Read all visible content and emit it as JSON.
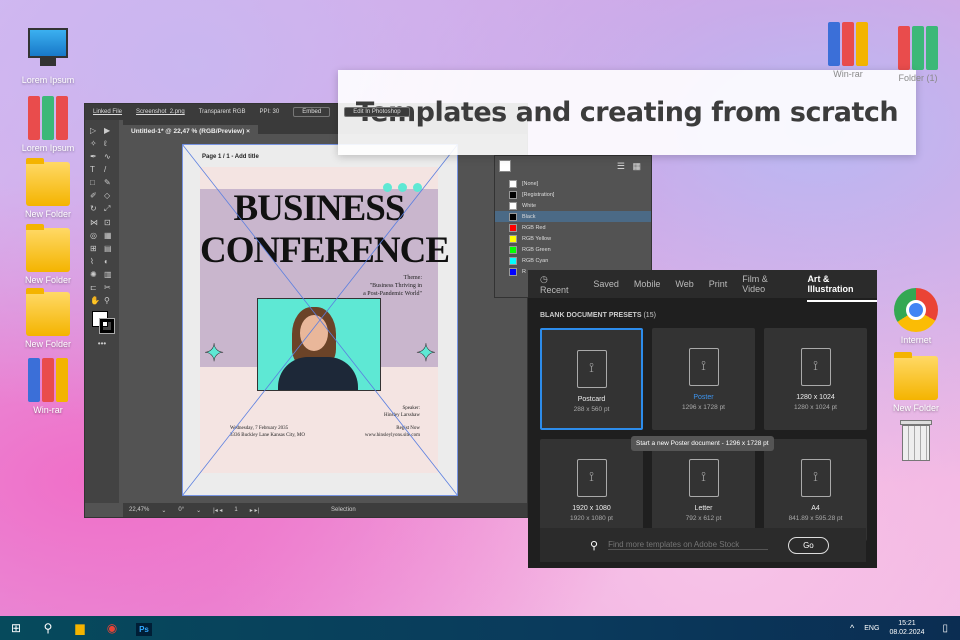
{
  "desktop": {
    "left": [
      {
        "label": "Lorem Ipsum",
        "icon": "computer-icon"
      },
      {
        "label": "Lorem Ipsum",
        "icon": "binders-icon"
      },
      {
        "label": "New Folder",
        "icon": "folder-icon"
      },
      {
        "label": "New Folder",
        "icon": "folder-icon"
      },
      {
        "label": "New Folder",
        "icon": "folder-icon"
      },
      {
        "label": "Win-rar",
        "icon": "winrar-icon"
      }
    ],
    "right": [
      {
        "label": "Win-rar"
      },
      {
        "label": "Folder (1)"
      },
      {
        "label": "Internet"
      },
      {
        "label": "New Folder"
      }
    ]
  },
  "banner": "Templates and creating from scratch",
  "illustrator": {
    "options": {
      "linked": "Linked File",
      "file": "Screenshot_2.png",
      "color": "Transparent RGB",
      "ppi": "PPI: 30",
      "embed": "Embed",
      "edit": "Edit In Photoshop"
    },
    "tab": "Untitled-1* @ 22,47 % (RGB/Preview)",
    "close": "×",
    "page_label": "Page 1 / 1 - Add title",
    "status": {
      "zoom": "22,47%",
      "angle": "0°",
      "page": "1",
      "tool": "Selection"
    },
    "poster": {
      "line1": "BUSINESS",
      "line2": "CONFERENCE",
      "theme": "Theme:",
      "theme_text1": "\"Business Thriving in",
      "theme_text2": "a Post-Pandemic World\"",
      "speaker": "Speaker:",
      "speaker_name": "Hinsley Larsshaw",
      "date": "Wednesday, 7 February 2035",
      "address": "3336 Buckley Lane Kansas City, MO",
      "register": "Regist Now",
      "site": "www.hinsleylyons.site.com"
    }
  },
  "swatches": [
    {
      "name": "[None]",
      "color": "#ffffff"
    },
    {
      "name": "[Registration]",
      "color": "#000000"
    },
    {
      "name": "White",
      "color": "#ffffff"
    },
    {
      "name": "Black",
      "color": "#000000",
      "selected": true
    },
    {
      "name": "RGB Red",
      "color": "#ff0000"
    },
    {
      "name": "RGB Yellow",
      "color": "#ffff00"
    },
    {
      "name": "RGB Green",
      "color": "#00ff00"
    },
    {
      "name": "RGB Cyan",
      "color": "#00ffff"
    },
    {
      "name": "R",
      "color": "#0000ff"
    }
  ],
  "new_doc": {
    "tabs": [
      "Recent",
      "Saved",
      "Mobile",
      "Web",
      "Print",
      "Film & Video",
      "Art & Illustration"
    ],
    "active_tab": "Art & Illustration",
    "section": "BLANK DOCUMENT PRESETS",
    "count": "(15)",
    "presets": [
      {
        "name": "Postcard",
        "size": "288 x 560 pt"
      },
      {
        "name": "Poster",
        "size": "1296 x 1728 pt"
      },
      {
        "name": "1280 x 1024",
        "size": "1280 x 1024 pt"
      },
      {
        "name": "1920 x 1080",
        "size": "1920 x 1080 pt"
      },
      {
        "name": "Letter",
        "size": "792 x 612 pt"
      },
      {
        "name": "A4",
        "size": "841.89 x 595.28 pt"
      }
    ],
    "tooltip": "Start a new Poster document - 1296 x 1728 pt",
    "search_placeholder": "Find more templates on Adobe Stock",
    "go": "Go"
  },
  "taskbar": {
    "lang": "ENG",
    "time": "15:21",
    "date": "08.02.2024"
  }
}
